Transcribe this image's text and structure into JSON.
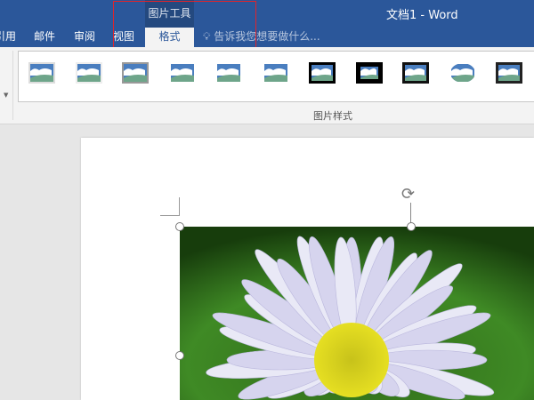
{
  "titlebar": {
    "doc_title": "文档1 - Word",
    "context_group": "图片工具"
  },
  "tabs": [
    "引用",
    "邮件",
    "审阅",
    "视图",
    "格式"
  ],
  "active_tab": "格式",
  "tell_me": "告诉我您想要做什么...",
  "ribbon": {
    "group_label": "图片样式",
    "style_count": 11
  },
  "colors": {
    "brand": "#2b579a",
    "highlight": "#e0242b"
  }
}
